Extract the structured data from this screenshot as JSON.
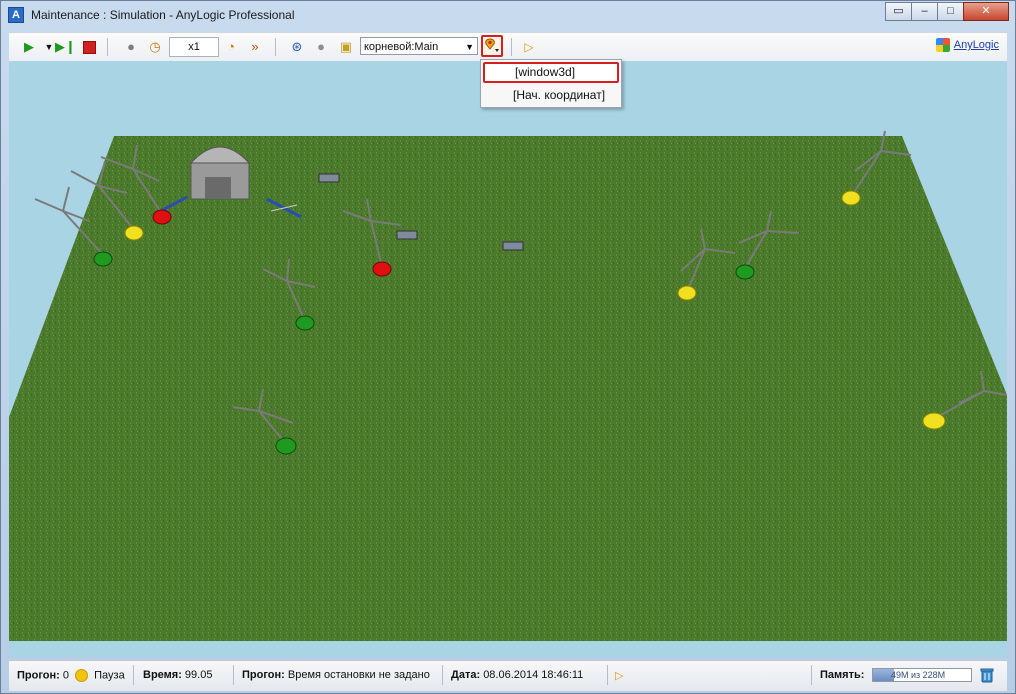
{
  "window": {
    "title": "Maintenance : Simulation - AnyLogic Professional",
    "app_icon": "anylogic-icon",
    "controls": [
      "minimize",
      "maximize",
      "close"
    ]
  },
  "toolbar": {
    "speed": "x1",
    "agent_combo": "корневой:Main",
    "brand": "AnyLogic",
    "icons": [
      "run-icon",
      "run-dropdown-icon",
      "step-icon",
      "stop-icon",
      "agent-icon",
      "speed-clock-icon",
      "speed-up-icon",
      "speed-fast-icon",
      "navigate-up-icon",
      "zoom-icon",
      "agent-navigate-icon",
      "viewarea-icon",
      "developer-panel-icon"
    ]
  },
  "viewarea_menu": {
    "items": [
      "[window3d]",
      "[Нач. координат]"
    ],
    "selected": "[window3d]"
  },
  "status": {
    "run_label": "Прогон:",
    "run_value": "0",
    "state": "Пауза",
    "time_label": "Время:",
    "time_value": "99.05",
    "run2_label": "Прогон:",
    "run2_value": "Время остановки не задано",
    "date_label": "Дата:",
    "date_value": "08.06.2014 18:46:11",
    "memory_label": "Память:",
    "memory_value": "49M из 228M",
    "memory_fraction": 0.215
  },
  "colors": {
    "titlebar": "#c8daee",
    "sky": "#a9d4e4",
    "grass": "#4c7a2c",
    "highlight": "#d42020",
    "turbine_green": "#1f9a1f",
    "turbine_yellow": "#f0e020",
    "turbine_red": "#e01010"
  }
}
